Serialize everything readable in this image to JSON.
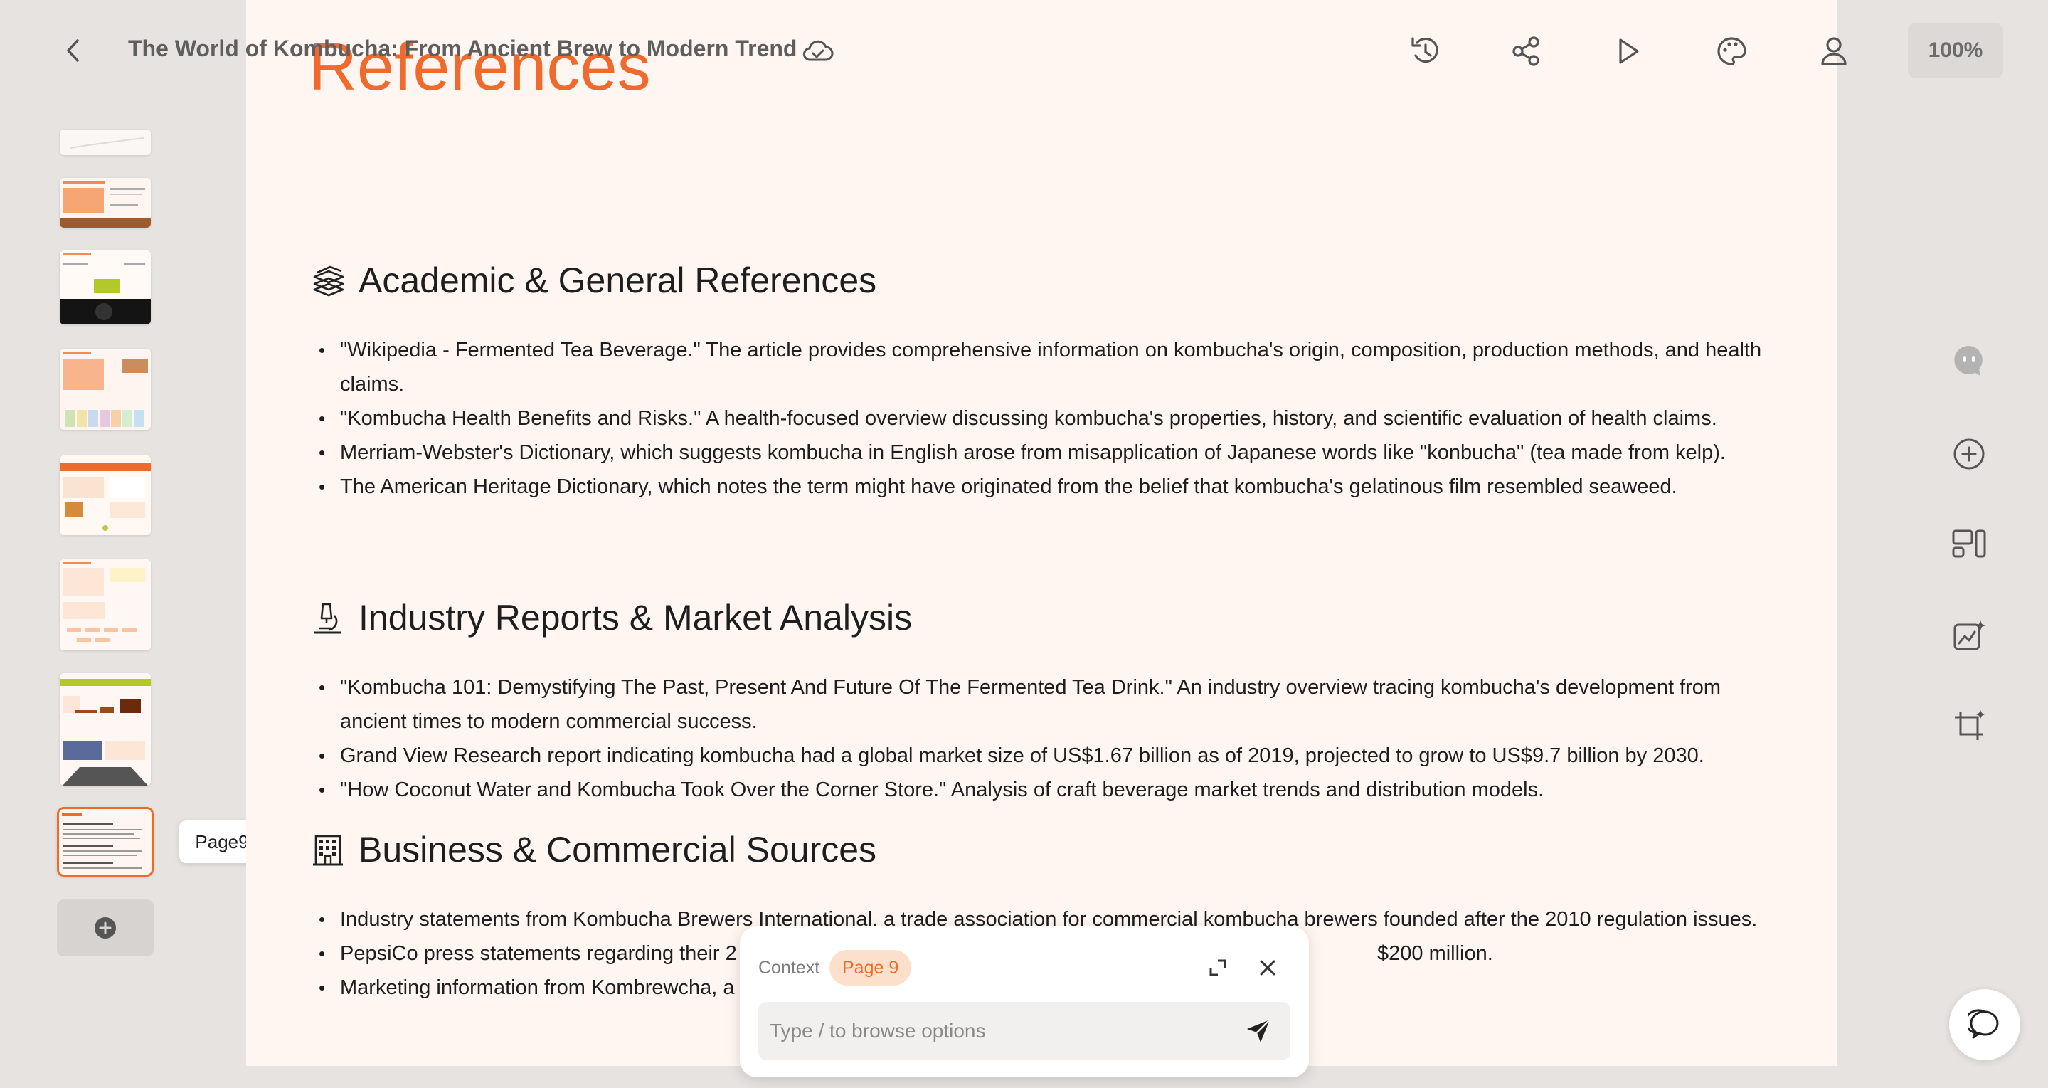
{
  "header": {
    "doc_title": "The World of Kombucha: From Ancient Brew to Modern Trend",
    "zoom": "100%"
  },
  "slide": {
    "title": "References",
    "sections": [
      {
        "icon": "books-icon",
        "heading": "Academic & General References",
        "items": [
          "\"Wikipedia - Fermented Tea Beverage.\" The article provides comprehensive information on kombucha's origin, composition, production methods, and health claims.",
          "\"Kombucha Health Benefits and Risks.\" A health-focused overview discussing kombucha's properties, history, and scientific evaluation of health claims.",
          "Merriam-Webster's Dictionary, which suggests kombucha in English arose from misapplication of Japanese words like \"konbucha\" (tea made from kelp).",
          "The American Heritage Dictionary, which notes the term might have originated from the belief that kombucha's gelatinous film resembled seaweed."
        ]
      },
      {
        "icon": "microscope-icon",
        "heading": "Industry Reports & Market Analysis",
        "items": [
          "\"Kombucha 101: Demystifying The Past, Present And Future Of The Fermented Tea Drink.\" An industry overview tracing kombucha's development from ancient times to modern commercial success.",
          "Grand View Research report indicating kombucha had a global market size of US$1.67 billion as of 2019, projected to grow to US$9.7 billion by 2030.",
          "\"How Coconut Water and Kombucha Took Over the Corner Store.\" Analysis of craft beverage market trends and distribution models."
        ]
      },
      {
        "icon": "office-building-icon",
        "heading": "Business & Commercial Sources",
        "items": [
          "Industry statements from Kombucha Brewers International, a trade association for commercial kombucha brewers founded after the 2010 regulation issues.",
          "PepsiCo press statements regarding their 2",
          "Marketing information from Kombrewcha, a"
        ],
        "item_tail": "$200 million."
      }
    ]
  },
  "sidebar": {
    "tooltip": "Page9",
    "active_page": 9
  },
  "context_panel": {
    "label": "Context",
    "chip": "Page 9",
    "input_placeholder": "Type / to browse options"
  },
  "colors": {
    "accent": "#f06a2d",
    "slide_bg": "#fff5f1",
    "app_bg": "#e6e3e0"
  }
}
